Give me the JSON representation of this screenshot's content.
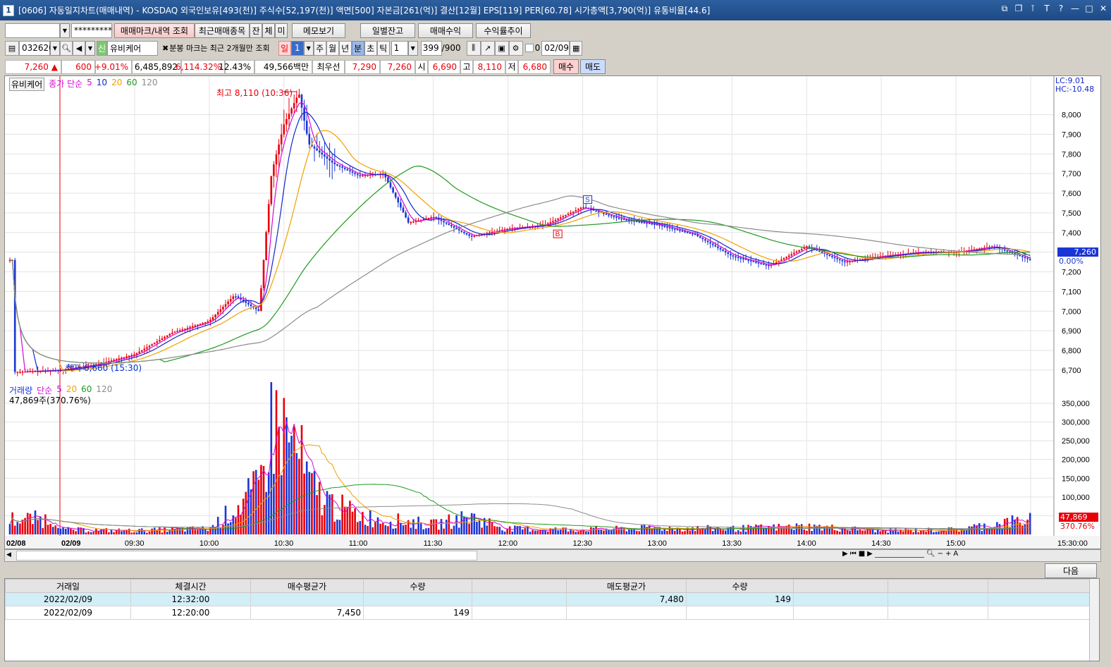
{
  "window": {
    "number": "1",
    "title": "[0606] 자동일지차트(매매내역) - KOSDAQ 외국인보유[493(천)] 주식수[52,197(천)] 액면[500] 자본금[261(억)] 결산[12월] EPS[119] PER[60.78] 시가총액[3,790(억)] 유통비율[44.6]"
  },
  "toolbar1": {
    "account_value": "",
    "password_value": "*********",
    "buttons": [
      "매매마크/내역 조회",
      "최근매매종목",
      "잔",
      "체",
      "미",
      "메모보기",
      "일별잔고",
      "매매수익",
      "수익률추이"
    ]
  },
  "toolbar2": {
    "code": "032620",
    "credit_badge": "신",
    "stock_name": "유비케어",
    "notice": "분봉 마크는 최근 2개월만 조회",
    "periods": [
      "일",
      "1",
      "주",
      "월",
      "년",
      "분",
      "초",
      "틱"
    ],
    "interval_value": "1",
    "count_value": "399",
    "count_total": "/900",
    "date_value": "02/09",
    "checkbox_label": "0"
  },
  "infobar": {
    "price": "7,260",
    "change_arrow": "▲",
    "change": "600",
    "change_pct": "+9.01%",
    "volume": "6,485,892",
    "volume_pct": "6,114.32%",
    "turnover": "12.43%",
    "amount": "49,566백만",
    "best_label": "최우선",
    "ask": "7,290",
    "bid": "7,260",
    "open_label": "시",
    "open": "6,690",
    "high_label": "고",
    "high": "8,110",
    "low_label": "저",
    "low": "6,680",
    "buy_button": "매수",
    "sell_button": "매도"
  },
  "price_chart": {
    "stock_label": "유비케어",
    "ma_label": "종가 단순",
    "ma_periods": [
      "5",
      "10",
      "20",
      "60",
      "120"
    ],
    "top_right_lc": "LC:9.01",
    "top_right_hc": "HC:-10.48",
    "high_annotation": "최고 8,110 (10:36)",
    "low_annotation": "최저 6,660 (15:30)",
    "current_price_tag": "7,260",
    "current_pct_tag": "0.00%",
    "buy_marker": "B",
    "sell_marker": "S"
  },
  "volume_chart": {
    "label": "거래량",
    "ma_label": "단순",
    "ma_periods": [
      "5",
      "20",
      "60",
      "120"
    ],
    "current_volume": "47,869주(370.76%)",
    "current_tag": "47,869",
    "current_pct_tag": "370.76%"
  },
  "x_axis": {
    "labels": [
      "02/08",
      "02/09",
      "09:30",
      "10:00",
      "10:30",
      "11:00",
      "11:30",
      "12:00",
      "12:30",
      "13:00",
      "13:30",
      "14:00",
      "14:30",
      "15:00",
      "15:30:00"
    ]
  },
  "colors": {
    "up": "#e8000b",
    "down": "#1a35d6",
    "ma5": "#d40ad4",
    "ma10": "#1428c8",
    "ma20": "#f0a000",
    "ma60": "#1f9a1f",
    "ma120": "#8c8c8c",
    "grid": "#e3e3e3"
  },
  "chart_data": [
    {
      "type": "line",
      "title": "유비케어",
      "ylabel": "",
      "y_ticks": [
        6700,
        6800,
        6900,
        7000,
        7100,
        7200,
        7300,
        7400,
        7500,
        7600,
        7700,
        7800,
        7900,
        8000
      ],
      "ylim": [
        6660,
        8160
      ],
      "x": [
        "02/08 15:20",
        "09:00",
        "09:15",
        "09:30",
        "09:45",
        "10:00",
        "10:10",
        "10:20",
        "10:25",
        "10:30",
        "10:36",
        "10:40",
        "10:50",
        "11:00",
        "11:10",
        "11:20",
        "11:30",
        "11:45",
        "12:00",
        "12:15",
        "12:30",
        "12:45",
        "13:00",
        "13:15",
        "13:30",
        "13:45",
        "14:00",
        "14:15",
        "14:30",
        "14:45",
        "15:00",
        "15:15",
        "15:30"
      ],
      "series": [
        {
          "name": "종가",
          "values": [
            6690,
            6700,
            6730,
            6780,
            6890,
            6950,
            7080,
            7000,
            7700,
            7950,
            8110,
            7850,
            7750,
            7690,
            7700,
            7450,
            7480,
            7380,
            7420,
            7440,
            7530,
            7470,
            7440,
            7390,
            7280,
            7230,
            7330,
            7250,
            7280,
            7300,
            7300,
            7330,
            7260
          ]
        }
      ]
    },
    {
      "type": "bar",
      "title": "거래량",
      "y_ticks": [
        50000,
        100000,
        150000,
        200000,
        250000,
        300000,
        350000
      ],
      "ylim": [
        0,
        380000
      ],
      "x": [
        "09:00",
        "09:30",
        "10:00",
        "10:20",
        "10:25",
        "10:30",
        "10:36",
        "10:40",
        "10:50",
        "11:00",
        "11:10",
        "11:20",
        "11:30",
        "11:45",
        "12:00",
        "12:30",
        "13:00",
        "13:30",
        "14:00",
        "14:30",
        "15:00",
        "15:30"
      ],
      "values": [
        15000,
        12000,
        18000,
        140000,
        360000,
        320000,
        250000,
        150000,
        90000,
        60000,
        45000,
        40000,
        30000,
        55000,
        18000,
        15000,
        20000,
        18000,
        25000,
        12000,
        15000,
        47869
      ]
    }
  ]
}
